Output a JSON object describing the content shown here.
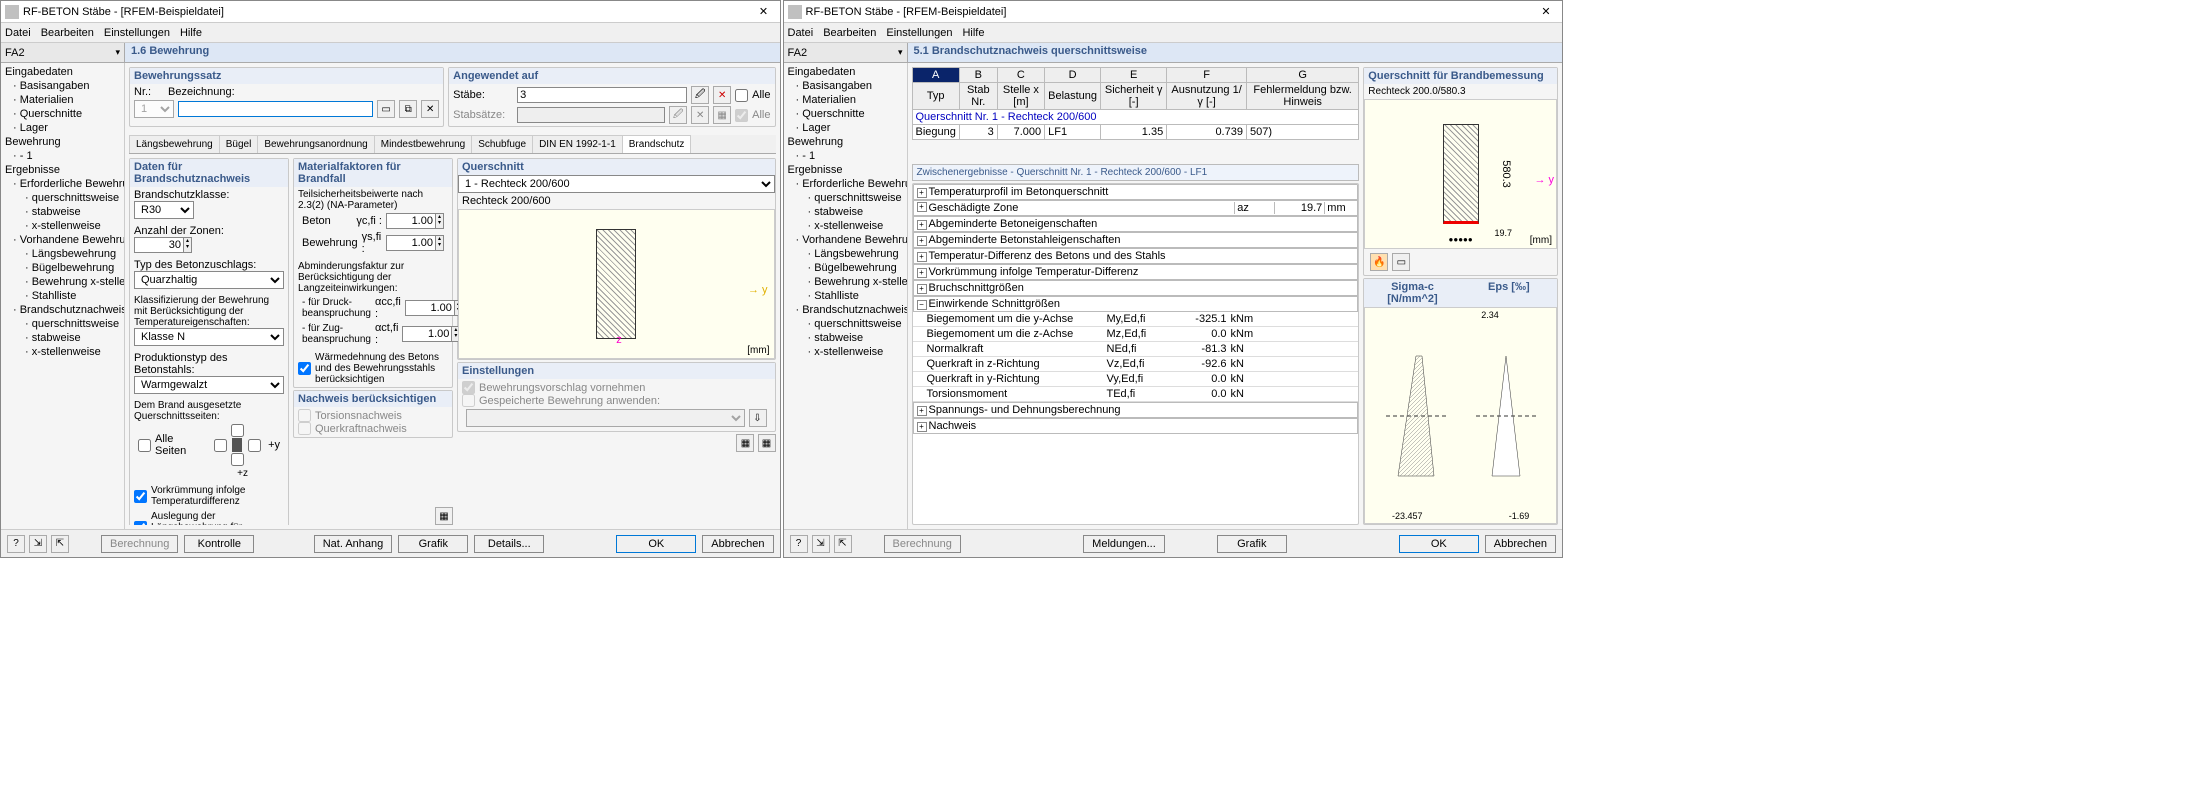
{
  "title": "RF-BETON Stäbe - [RFEM-Beispieldatei]",
  "menus": [
    "Datei",
    "Bearbeiten",
    "Einstellungen",
    "Hilfe"
  ],
  "case": "FA2",
  "left": {
    "panetitle": "1.6 Bewehrung",
    "tree": [
      {
        "t": "Eingabedaten",
        "lvl": 0
      },
      {
        "t": "Basisangaben",
        "lvl": 1
      },
      {
        "t": "Materialien",
        "lvl": 1
      },
      {
        "t": "Querschnitte",
        "lvl": 1
      },
      {
        "t": "Lager",
        "lvl": 1
      },
      {
        "t": "Bewehrung",
        "lvl": 0
      },
      {
        "t": "- 1",
        "lvl": 1
      },
      {
        "t": "Ergebnisse",
        "lvl": 0
      },
      {
        "t": "Erforderliche Bewehrung",
        "lvl": 1
      },
      {
        "t": "querschnittsweise",
        "lvl": 2
      },
      {
        "t": "stabweise",
        "lvl": 2
      },
      {
        "t": "x-stellenweise",
        "lvl": 2
      },
      {
        "t": "Vorhandene Bewehrung",
        "lvl": 1
      },
      {
        "t": "Längsbewehrung",
        "lvl": 2
      },
      {
        "t": "Bügelbewehrung",
        "lvl": 2
      },
      {
        "t": "Bewehrung x-stellenweise",
        "lvl": 2
      },
      {
        "t": "Stahlliste",
        "lvl": 2
      },
      {
        "t": "Brandschutznachweis",
        "lvl": 1
      },
      {
        "t": "querschnittsweise",
        "lvl": 2
      },
      {
        "t": "stabweise",
        "lvl": 2
      },
      {
        "t": "x-stellenweise",
        "lvl": 2
      }
    ],
    "bewsatz_head": "Bewehrungssatz",
    "angewendet_head": "Angewendet auf",
    "nr_label": "Nr.:",
    "bez_label": "Bezeichnung:",
    "nr_val": "1",
    "staebe_label": "Stäbe:",
    "staebe_val": "3",
    "alle_lbl": "Alle",
    "stabsaetze_label": "Stabsätze:",
    "alle2_lbl": "Alle",
    "tabs": [
      "Längsbewehrung",
      "Bügel",
      "Bewehrungsanordnung",
      "Mindestbewehrung",
      "Schubfuge",
      "DIN EN 1992-1-1",
      "Brandschutz"
    ],
    "data_head": "Daten für Brandschutznachweis",
    "bsk_label": "Brandschutzklasse:",
    "bsk_val": "R30",
    "zonen_label": "Anzahl der Zonen:",
    "zonen_val": "30",
    "zuschlag_label": "Typ des Betonzuschlags:",
    "zuschlag_val": "Quarzhaltig",
    "klass_label": "Klassifizierung der Bewehrung mit Berücksichtigung der Temperatureigenschaften:",
    "klass_val": "Klasse N",
    "prod_label": "Produktionstyp des Betonstahls:",
    "prod_val": "Warmgewalzt",
    "brand_label": "Dem Brand ausgesetzte Querschnittsseiten:",
    "alleseiten_lbl": "Alle Seiten",
    "side_py": "+y",
    "side_pz": "+z",
    "vor_label": "Vorkrümmung infolge Temperaturdifferenz",
    "ausl_label": "Auslegung der Längsbewehrung für Brandschutznachweis",
    "mat_head": "Materialfaktoren für Brandfall",
    "teil_label": "Teilsicherheitsbeiwerte nach 2.3(2) (NA-Parameter)",
    "beton_label": "Beton",
    "gamma_cfi": "γc,fi :",
    "beton_val": "1.00",
    "bew_label": "Bewehrung",
    "gamma_sfi": "γs,fi :",
    "bew_val": "1.00",
    "abm_label": "Abminderungsfaktur zur Berücksichtigung der Langzeiteinwirkungen:",
    "druck_label": "- für Druck- beanspruchung",
    "alpha_cc": "αcc,fi :",
    "druck_val": "1.00",
    "zug_label": "- für Zug- beanspruchung",
    "alpha_ct": "αct,fi :",
    "zug_val": "1.00",
    "waerme_label": "Wärmedehnung des Betons und des Bewehrungsstahls berücksichtigen",
    "nachw_head": "Nachweis berücksichtigen",
    "tors_label": "Torsionsnachweis",
    "querk_label": "Querkraftnachweis",
    "qs_head": "Querschnitt",
    "qs_val": "1 - Rechteck 200/600",
    "qs_res": "Rechteck 200/600",
    "einstell_head": "Einstellungen",
    "bv_label": "Bewehrungsvorschlag vornehmen",
    "gb_label": "Gespeicherte Bewehrung anwenden:",
    "footer_btns": [
      "Berechnung",
      "Kontrolle",
      "Nat. Anhang",
      "Grafik",
      "Details...",
      "OK",
      "Abbrechen"
    ]
  },
  "right": {
    "panetitle": "5.1 Brandschutznachweis querschnittsweise",
    "tree": [
      {
        "t": "Eingabedaten",
        "lvl": 0
      },
      {
        "t": "Basisangaben",
        "lvl": 1
      },
      {
        "t": "Materialien",
        "lvl": 1
      },
      {
        "t": "Querschnitte",
        "lvl": 1
      },
      {
        "t": "Lager",
        "lvl": 1
      },
      {
        "t": "Bewehrung",
        "lvl": 0
      },
      {
        "t": "- 1",
        "lvl": 1
      },
      {
        "t": "Ergebnisse",
        "lvl": 0
      },
      {
        "t": "Erforderliche Bewehrung",
        "lvl": 1
      },
      {
        "t": "querschnittsweise",
        "lvl": 2
      },
      {
        "t": "stabweise",
        "lvl": 2
      },
      {
        "t": "x-stellenweise",
        "lvl": 2
      },
      {
        "t": "Vorhandene Bewehrung",
        "lvl": 1
      },
      {
        "t": "Längsbewehrung",
        "lvl": 2
      },
      {
        "t": "Bügelbewehrung",
        "lvl": 2
      },
      {
        "t": "Bewehrung x-stellenweise",
        "lvl": 2
      },
      {
        "t": "Stahlliste",
        "lvl": 2
      },
      {
        "t": "Brandschutznachweis",
        "lvl": 1
      },
      {
        "t": "querschnittsweise",
        "lvl": 2
      },
      {
        "t": "stabweise",
        "lvl": 2
      },
      {
        "t": "x-stellenweise",
        "lvl": 2
      }
    ],
    "cols": [
      "A",
      "B",
      "C",
      "D",
      "E",
      "F",
      "G"
    ],
    "hdr": [
      "Typ",
      "Stab Nr.",
      "Stelle x [m]",
      "Belastung",
      "Sicherheit γ [-]",
      "Ausnutzung 1/γ [-]",
      "Fehlermeldung bzw. Hinweis"
    ],
    "grprow": "Querschnitt Nr. 1 - Rechteck 200/600",
    "row": [
      "Biegung",
      "3",
      "7.000",
      "LF1",
      "1.35",
      "0.739",
      "507)"
    ],
    "zwi_head": "Zwischenergebnisse  -  Querschnitt Nr. 1 - Rechteck 200/600  -  LF1",
    "groups": [
      "Temperaturprofil im Betonquerschnitt",
      "Abgeminderte Betoneigenschaften",
      "Abgeminderte Betonstahleigenschaften",
      "Temperatur-Differenz des Betons und des Stahls",
      "Vorkrümmung infolge Temperatur-Differenz",
      "Bruchschnittgrößen"
    ],
    "gez_head": "Geschädigte Zone",
    "gez_sym": "az",
    "gez_val": "19.7",
    "gez_unit": "mm",
    "eink_head": "Einwirkende Schnittgrößen",
    "eink": [
      [
        "Biegemoment um die y-Achse",
        "My,Ed,fi",
        "-325.1",
        "kNm"
      ],
      [
        "Biegemoment um die z-Achse",
        "Mz,Ed,fi",
        "0.0",
        "kNm"
      ],
      [
        "Normalkraft",
        "NEd,fi",
        "-81.3",
        "kN"
      ],
      [
        "Querkraft in z-Richtung",
        "Vz,Ed,fi",
        "-92.6",
        "kN"
      ],
      [
        "Querkraft in y-Richtung",
        "Vy,Ed,fi",
        "0.0",
        "kN"
      ],
      [
        "Torsionsmoment",
        "TEd,fi",
        "0.0",
        "kN"
      ]
    ],
    "spann_head": "Spannungs- und Dehnungsberechnung",
    "nachw_head": "Nachweis",
    "qpanel_head": "Querschnitt für Brandbemessung",
    "qpanel_sub": "Rechteck 200.0/580.3",
    "dim1": "580.3",
    "dim2": "19.7",
    "mm": "[mm]",
    "sigma_head": "Sigma-c [N/mm^2]",
    "eps_head": "Eps [‰]",
    "val_top": "2.34",
    "val_left": "-23.457",
    "val_right": "-1.69",
    "footer_btns": [
      "Berechnung",
      "Meldungen...",
      "Grafik",
      "OK",
      "Abbrechen"
    ]
  }
}
